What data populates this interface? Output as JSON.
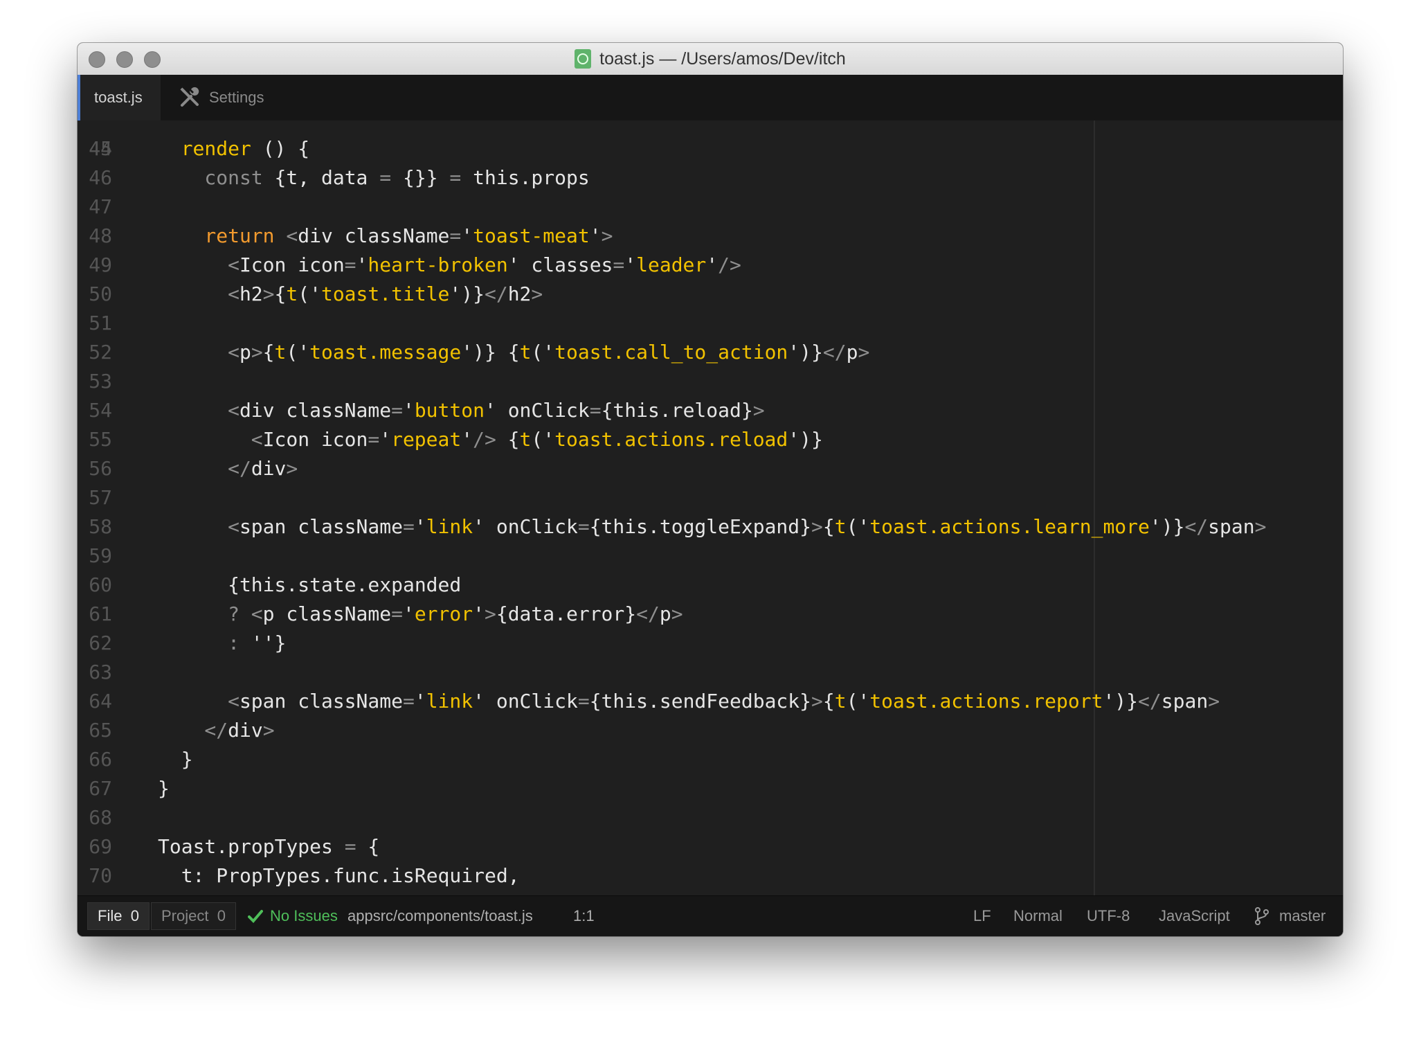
{
  "window": {
    "title": "toast.js — /Users/amos/Dev/itch",
    "file_icon": "atom-file-icon"
  },
  "tabs": [
    {
      "label": "toast.js",
      "active": true
    },
    {
      "label": "Settings",
      "icon": "tools-icon"
    }
  ],
  "editor": {
    "lines": [
      {
        "n": "45",
        "indent": 2,
        "tokens": [
          [
            "render",
            "k"
          ],
          [
            " () {",
            "d"
          ]
        ]
      },
      {
        "n": "46",
        "indent": 4,
        "tokens": [
          [
            "const",
            "c"
          ],
          [
            " {t, data ",
            "d"
          ],
          [
            "=",
            "p"
          ],
          [
            " {}} ",
            "d"
          ],
          [
            "=",
            "p"
          ],
          [
            " this.props",
            "d"
          ]
        ]
      },
      {
        "n": "47",
        "indent": 0,
        "tokens": []
      },
      {
        "n": "48",
        "indent": 4,
        "tokens": [
          [
            "return",
            "r"
          ],
          [
            " <",
            "p"
          ],
          [
            "div className",
            "d"
          ],
          [
            "=",
            "p"
          ],
          [
            "'",
            "d"
          ],
          [
            "toast-meat",
            "s"
          ],
          [
            "'",
            "d"
          ],
          [
            ">",
            "p"
          ]
        ]
      },
      {
        "n": "49",
        "indent": 6,
        "tokens": [
          [
            "<",
            "p"
          ],
          [
            "Icon icon",
            "d"
          ],
          [
            "=",
            "p"
          ],
          [
            "'",
            "d"
          ],
          [
            "heart-broken",
            "s"
          ],
          [
            "' classes",
            "d"
          ],
          [
            "=",
            "p"
          ],
          [
            "'",
            "d"
          ],
          [
            "leader",
            "s"
          ],
          [
            "'",
            "d"
          ],
          [
            "/>",
            "p"
          ]
        ]
      },
      {
        "n": "50",
        "indent": 6,
        "tokens": [
          [
            "<",
            "p"
          ],
          [
            "h2",
            "d"
          ],
          [
            ">",
            "p"
          ],
          [
            "{",
            "d"
          ],
          [
            "t",
            "s"
          ],
          [
            "('",
            "d"
          ],
          [
            "toast.title",
            "s"
          ],
          [
            "')}",
            "d"
          ],
          [
            "</",
            "p"
          ],
          [
            "h2",
            "d"
          ],
          [
            ">",
            "p"
          ]
        ]
      },
      {
        "n": "51",
        "indent": 0,
        "tokens": []
      },
      {
        "n": "52",
        "indent": 6,
        "tokens": [
          [
            "<",
            "p"
          ],
          [
            "p",
            "d"
          ],
          [
            ">",
            "p"
          ],
          [
            "{",
            "d"
          ],
          [
            "t",
            "s"
          ],
          [
            "('",
            "d"
          ],
          [
            "toast.message",
            "s"
          ],
          [
            "')} {",
            "d"
          ],
          [
            "t",
            "s"
          ],
          [
            "('",
            "d"
          ],
          [
            "toast.call_to_action",
            "s"
          ],
          [
            "')}",
            "d"
          ],
          [
            "</",
            "p"
          ],
          [
            "p",
            "d"
          ],
          [
            ">",
            "p"
          ]
        ]
      },
      {
        "n": "53",
        "indent": 0,
        "tokens": []
      },
      {
        "n": "54",
        "indent": 6,
        "tokens": [
          [
            "<",
            "p"
          ],
          [
            "div className",
            "d"
          ],
          [
            "=",
            "p"
          ],
          [
            "'",
            "d"
          ],
          [
            "button",
            "s"
          ],
          [
            "' onClick",
            "d"
          ],
          [
            "=",
            "p"
          ],
          [
            "{this.reload}",
            "d"
          ],
          [
            ">",
            "p"
          ]
        ]
      },
      {
        "n": "55",
        "indent": 8,
        "tokens": [
          [
            "<",
            "p"
          ],
          [
            "Icon icon",
            "d"
          ],
          [
            "=",
            "p"
          ],
          [
            "'",
            "d"
          ],
          [
            "repeat",
            "s"
          ],
          [
            "'",
            "d"
          ],
          [
            "/>",
            "p"
          ],
          [
            " {",
            "d"
          ],
          [
            "t",
            "s"
          ],
          [
            "('",
            "d"
          ],
          [
            "toast.actions.reload",
            "s"
          ],
          [
            "')}",
            "d"
          ]
        ]
      },
      {
        "n": "56",
        "indent": 6,
        "tokens": [
          [
            "</",
            "p"
          ],
          [
            "div",
            "d"
          ],
          [
            ">",
            "p"
          ]
        ]
      },
      {
        "n": "57",
        "indent": 0,
        "tokens": []
      },
      {
        "n": "58",
        "indent": 6,
        "tokens": [
          [
            "<",
            "p"
          ],
          [
            "span className",
            "d"
          ],
          [
            "=",
            "p"
          ],
          [
            "'",
            "d"
          ],
          [
            "link",
            "s"
          ],
          [
            "' onClick",
            "d"
          ],
          [
            "=",
            "p"
          ],
          [
            "{this.toggleExpand}",
            "d"
          ],
          [
            ">",
            "p"
          ],
          [
            "{",
            "d"
          ],
          [
            "t",
            "s"
          ],
          [
            "('",
            "d"
          ],
          [
            "toast.actions.learn_more",
            "s"
          ],
          [
            "')}",
            "d"
          ],
          [
            "</",
            "p"
          ],
          [
            "span",
            "d"
          ],
          [
            ">",
            "p"
          ]
        ]
      },
      {
        "n": "59",
        "indent": 0,
        "tokens": []
      },
      {
        "n": "60",
        "indent": 6,
        "tokens": [
          [
            "{this.state.expanded",
            "d"
          ]
        ]
      },
      {
        "n": "61",
        "indent": 6,
        "tokens": [
          [
            "?",
            "p"
          ],
          [
            " <",
            "p"
          ],
          [
            "p className",
            "d"
          ],
          [
            "=",
            "p"
          ],
          [
            "'",
            "d"
          ],
          [
            "error",
            "s"
          ],
          [
            "'",
            "d"
          ],
          [
            ">",
            "p"
          ],
          [
            "{data.error}",
            "d"
          ],
          [
            "</",
            "p"
          ],
          [
            "p",
            "d"
          ],
          [
            ">",
            "p"
          ]
        ]
      },
      {
        "n": "62",
        "indent": 6,
        "tokens": [
          [
            ":",
            "p"
          ],
          [
            " ''}",
            "d"
          ]
        ]
      },
      {
        "n": "63",
        "indent": 0,
        "tokens": []
      },
      {
        "n": "64",
        "indent": 6,
        "tokens": [
          [
            "<",
            "p"
          ],
          [
            "span className",
            "d"
          ],
          [
            "=",
            "p"
          ],
          [
            "'",
            "d"
          ],
          [
            "link",
            "s"
          ],
          [
            "' onClick",
            "d"
          ],
          [
            "=",
            "p"
          ],
          [
            "{this.sendFeedback}",
            "d"
          ],
          [
            ">",
            "p"
          ],
          [
            "{",
            "d"
          ],
          [
            "t",
            "s"
          ],
          [
            "('",
            "d"
          ],
          [
            "toast.actions.report",
            "s"
          ],
          [
            "')}",
            "d"
          ],
          [
            "</",
            "p"
          ],
          [
            "span",
            "d"
          ],
          [
            ">",
            "p"
          ]
        ]
      },
      {
        "n": "65",
        "indent": 4,
        "tokens": [
          [
            "</",
            "p"
          ],
          [
            "div",
            "d"
          ],
          [
            ">",
            "p"
          ]
        ]
      },
      {
        "n": "66",
        "indent": 2,
        "tokens": [
          [
            "}",
            "d"
          ]
        ]
      },
      {
        "n": "67",
        "indent": 0,
        "tokens": [
          [
            "}",
            "d"
          ]
        ]
      },
      {
        "n": "68",
        "indent": 0,
        "tokens": []
      },
      {
        "n": "69",
        "indent": 0,
        "tokens": [
          [
            "Toast.propTypes ",
            "d"
          ],
          [
            "=",
            "p"
          ],
          [
            " {",
            "d"
          ]
        ]
      },
      {
        "n": "70",
        "indent": 2,
        "tokens": [
          [
            "t: PropTypes.func.isRequired,",
            "d"
          ]
        ]
      }
    ]
  },
  "statusbar": {
    "file_label": "File",
    "file_count": "0",
    "project_label": "Project",
    "project_count": "0",
    "issues": "No Issues",
    "path": "appsrc/components/toast.js",
    "cursor": "1:1",
    "line_ending": "LF",
    "mode": "Normal",
    "encoding": "UTF-8",
    "grammar": "JavaScript",
    "branch": "master"
  }
}
